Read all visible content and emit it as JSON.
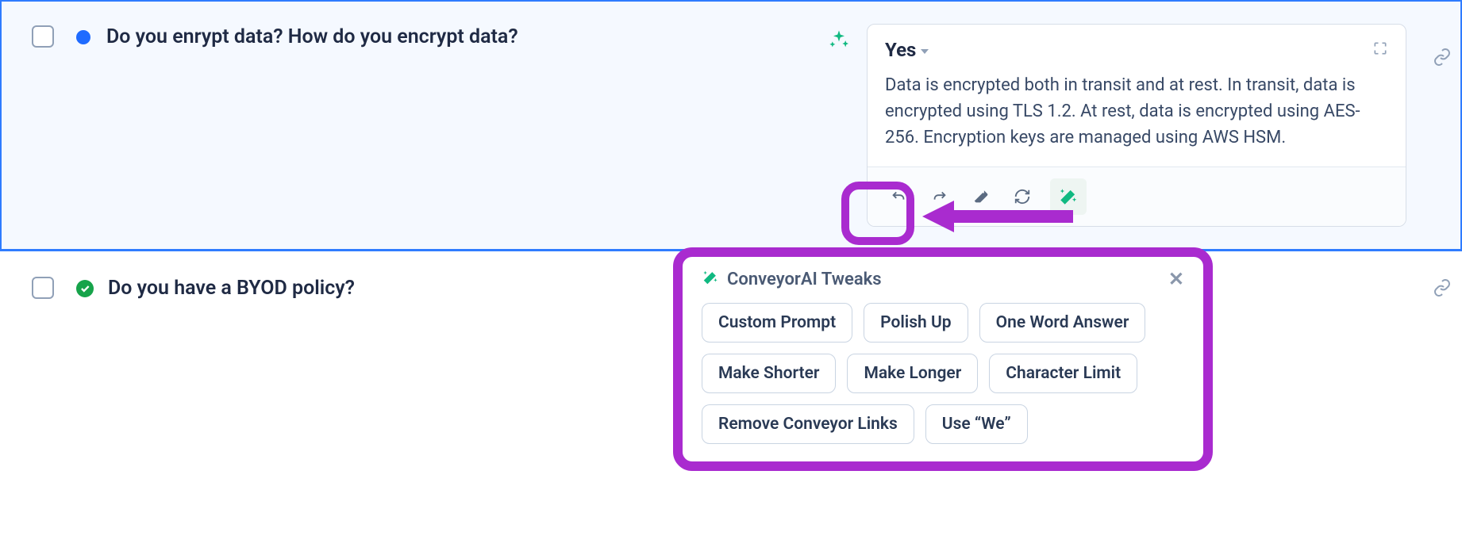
{
  "rows": [
    {
      "question": "Do you enrypt data? How do you encrypt data?",
      "answer_label": "Yes",
      "answer_body": "Data is encrypted both in transit and at rest. In transit, data is encrypted using TLS 1.2. At rest, data is encrypted using AES-256. Encryption keys are managed using AWS HSM."
    },
    {
      "question": "Do you have a BYOD policy?"
    }
  ],
  "tweaks": {
    "title": "ConveyorAI Tweaks",
    "options": [
      "Custom Prompt",
      "Polish Up",
      "One Word Answer",
      "Make Shorter",
      "Make Longer",
      "Character Limit",
      "Remove Conveyor Links",
      "Use “We”"
    ]
  },
  "colors": {
    "annotation": "#a92bcf",
    "accent_green": "#10b981",
    "accent_blue": "#2f7cff"
  }
}
